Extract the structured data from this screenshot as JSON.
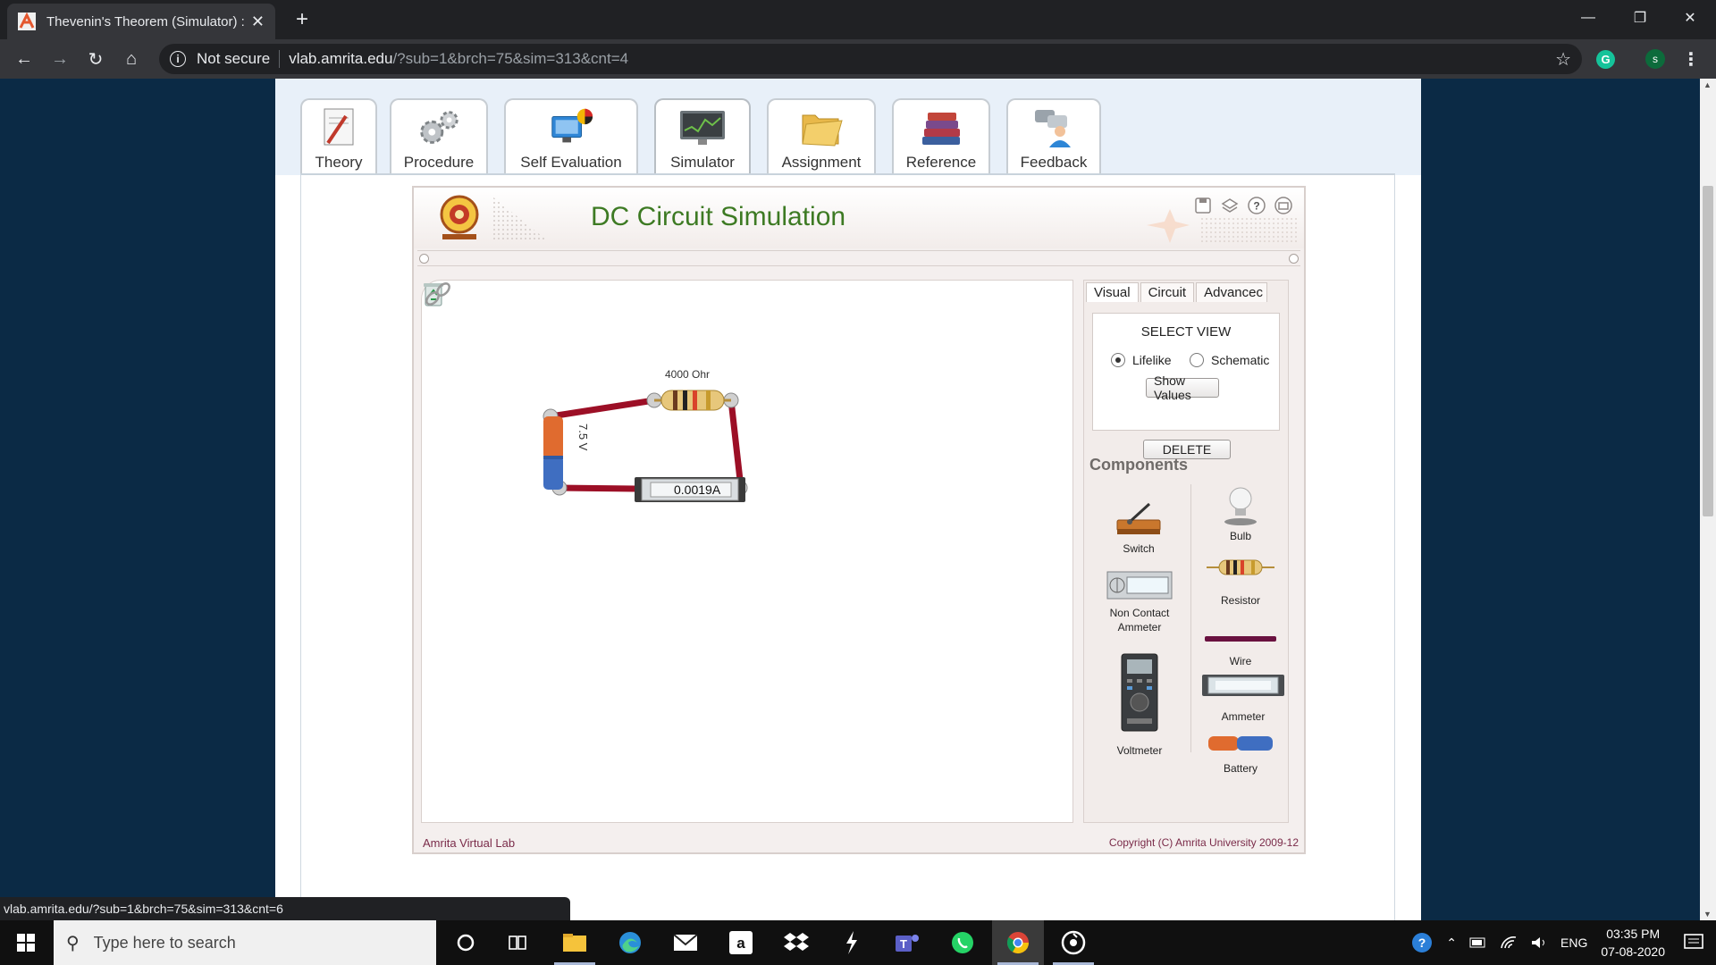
{
  "browser": {
    "tab_title": "Thevenin's Theorem (Simulator) :",
    "tab_close": "✕",
    "new_tab": "+",
    "minimize": "—",
    "restore": "❐",
    "close": "✕",
    "security_label": "Not secure",
    "url_host": "vlab.amrita.edu",
    "url_path": "/?sub=1&brch=75&sim=313&cnt=4",
    "profile_initial": "s",
    "grammarly_letter": "G",
    "status_url": "vlab.amrita.edu/?sub=1&brch=75&sim=313&cnt=6"
  },
  "nav_tabs": [
    {
      "label": "Theory",
      "icon": "theory-icon"
    },
    {
      "label": "Procedure",
      "icon": "gears-icon"
    },
    {
      "label": "Self Evaluation",
      "icon": "self-evaluation-icon"
    },
    {
      "label": "Simulator",
      "icon": "monitor-icon"
    },
    {
      "label": "Assignment",
      "icon": "folder-icon"
    },
    {
      "label": "Reference",
      "icon": "books-icon"
    },
    {
      "label": "Feedback",
      "icon": "feedback-icon"
    }
  ],
  "simulator": {
    "title": "DC Circuit Simulation",
    "header_icons": [
      "save-icon",
      "load-icon",
      "help-icon",
      "fullscreen-icon"
    ],
    "circuit": {
      "resistor_label": "4000 Ohr",
      "battery_label": "7.5 V",
      "ammeter_reading": "0.0019A"
    },
    "panel": {
      "tabs": [
        "Visual",
        "Circuit",
        "Advancec"
      ],
      "select_view_title": "SELECT VIEW",
      "option_lifelike": "Lifelike",
      "option_schematic": "Schematic",
      "selected_view": "Lifelike",
      "show_values": "Show Values",
      "delete": "DELETE",
      "components_title": "Components",
      "components": {
        "switch": "Switch",
        "bulb": "Bulb",
        "resistor": "Resistor",
        "non_contact_ammeter_1": "Non Contact",
        "non_contact_ammeter_2": "Ammeter",
        "wire": "Wire",
        "ammeter": "Ammeter",
        "voltmeter": "Voltmeter",
        "battery": "Battery"
      }
    },
    "footer_left": "Amrita Virtual Lab",
    "footer_right": "Copyright (C) Amrita University 2009-12"
  },
  "taskbar": {
    "search_placeholder": "Type here to search",
    "apps": [
      "cortana-icon",
      "task-view-icon",
      "file-explorer-icon",
      "edge-icon",
      "mail-icon",
      "amazon-icon",
      "dropbox-icon",
      "winamp-icon",
      "teams-icon",
      "whatsapp-icon",
      "chrome-icon",
      "media-icon"
    ],
    "language": "ENG",
    "time": "03:35 PM",
    "date": "07-08-2020"
  },
  "colors": {
    "page_bg": "#0b2a45",
    "title_green": "#3d7a23",
    "footer_text": "#7a2b49",
    "wire": "#b0132a"
  }
}
